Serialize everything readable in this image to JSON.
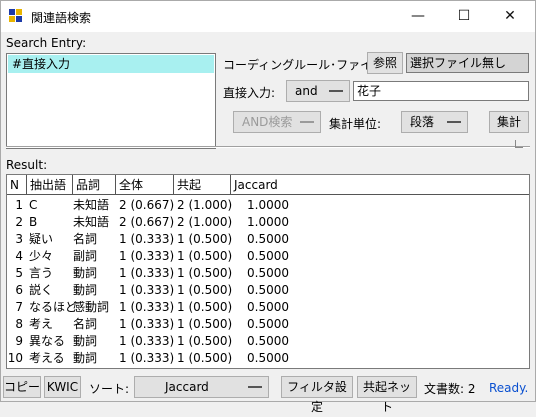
{
  "window": {
    "title": "関連語検索",
    "minimize_glyph": "—",
    "maximize_glyph": "☐",
    "close_glyph": "✕",
    "icon_colors": [
      "#1c3aa8",
      "#e8b400",
      "#e8b400",
      "#1c3aa8"
    ]
  },
  "search_entry": {
    "label": "Search Entry:",
    "items": [
      "#直接入力"
    ]
  },
  "coding_rule": {
    "label": "コーディングルール･ファイル:",
    "browse_label": "参照",
    "file_value": "選択ファイル無し"
  },
  "direct_input": {
    "label": "直接入力:",
    "operator": "and",
    "value": "花子"
  },
  "controls": {
    "and_search_label": "AND検索",
    "unit_label": "集計単位:",
    "unit_value": "段落",
    "aggregate_label": "集計"
  },
  "result": {
    "label": "Result:",
    "columns": [
      "N",
      "抽出語",
      "品詞",
      "全体",
      "共起",
      "Jaccard"
    ],
    "rows": [
      [
        "1",
        "C",
        "未知語",
        "2 (0.667)",
        "2 (1.000)",
        "1.0000"
      ],
      [
        "2",
        "B",
        "未知語",
        "2 (0.667)",
        "2 (1.000)",
        "1.0000"
      ],
      [
        "3",
        "疑い",
        "名詞",
        "1 (0.333)",
        "1 (0.500)",
        "0.5000"
      ],
      [
        "4",
        "少々",
        "副詞",
        "1 (0.333)",
        "1 (0.500)",
        "0.5000"
      ],
      [
        "5",
        "言う",
        "動詞",
        "1 (0.333)",
        "1 (0.500)",
        "0.5000"
      ],
      [
        "6",
        "説く",
        "動詞",
        "1 (0.333)",
        "1 (0.500)",
        "0.5000"
      ],
      [
        "7",
        "なるほど",
        "感動詞",
        "1 (0.333)",
        "1 (0.500)",
        "0.5000"
      ],
      [
        "8",
        "考え",
        "名詞",
        "1 (0.333)",
        "1 (0.500)",
        "0.5000"
      ],
      [
        "9",
        "異なる",
        "動詞",
        "1 (0.333)",
        "1 (0.500)",
        "0.5000"
      ],
      [
        "10",
        "考える",
        "動詞",
        "1 (0.333)",
        "1 (0.500)",
        "0.5000"
      ]
    ]
  },
  "bottom": {
    "copy_label": "コピー",
    "kwic_label": "KWIC",
    "sort_label": "ソート:",
    "sort_value": "Jaccard",
    "filter_label": "フィルタ設定",
    "network_label": "共起ネット",
    "doc_count": "文書数: 2",
    "status": "Ready."
  }
}
